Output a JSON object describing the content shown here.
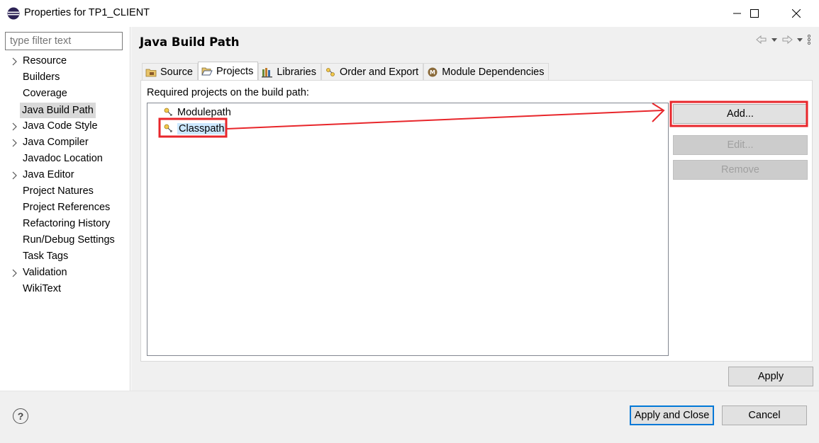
{
  "window": {
    "title": "Properties for TP1_CLIENT",
    "app_icon": "eclipse-icon",
    "controls": {
      "minimize": "minimize-icon",
      "maximize": "maximize-icon",
      "close": "close-icon"
    }
  },
  "sidebar": {
    "filter_placeholder": "type filter text",
    "items": [
      {
        "label": "Resource",
        "expandable": true
      },
      {
        "label": "Builders",
        "expandable": false
      },
      {
        "label": "Coverage",
        "expandable": false
      },
      {
        "label": "Java Build Path",
        "expandable": false,
        "selected": true
      },
      {
        "label": "Java Code Style",
        "expandable": true
      },
      {
        "label": "Java Compiler",
        "expandable": true
      },
      {
        "label": "Javadoc Location",
        "expandable": false
      },
      {
        "label": "Java Editor",
        "expandable": true
      },
      {
        "label": "Project Natures",
        "expandable": false
      },
      {
        "label": "Project References",
        "expandable": false
      },
      {
        "label": "Refactoring History",
        "expandable": false
      },
      {
        "label": "Run/Debug Settings",
        "expandable": false
      },
      {
        "label": "Task Tags",
        "expandable": false
      },
      {
        "label": "Validation",
        "expandable": true
      },
      {
        "label": "WikiText",
        "expandable": false
      }
    ]
  },
  "page": {
    "title": "Java Build Path",
    "tabs": [
      {
        "label": "Source",
        "icon": "source-folder-icon"
      },
      {
        "label": "Projects",
        "icon": "open-folder-icon",
        "active": true
      },
      {
        "label": "Libraries",
        "icon": "libraries-icon"
      },
      {
        "label": "Order and Export",
        "icon": "order-export-icon"
      },
      {
        "label": "Module Dependencies",
        "icon": "module-icon"
      }
    ],
    "required_label": "Required projects on the build path:",
    "list": [
      {
        "label": "Modulepath",
        "icon": "path-entry-icon"
      },
      {
        "label": "Classpath",
        "icon": "path-entry-icon",
        "selected": true
      }
    ],
    "buttons": {
      "add": "Add...",
      "edit": "Edit...",
      "remove": "Remove"
    },
    "apply": "Apply"
  },
  "footer": {
    "help_icon": "help-icon",
    "apply_close": "Apply and Close",
    "cancel": "Cancel"
  },
  "colors": {
    "annotation_red": "#e8262b",
    "selection_blue": "#cce8ff",
    "focus_blue": "#0078d7"
  }
}
